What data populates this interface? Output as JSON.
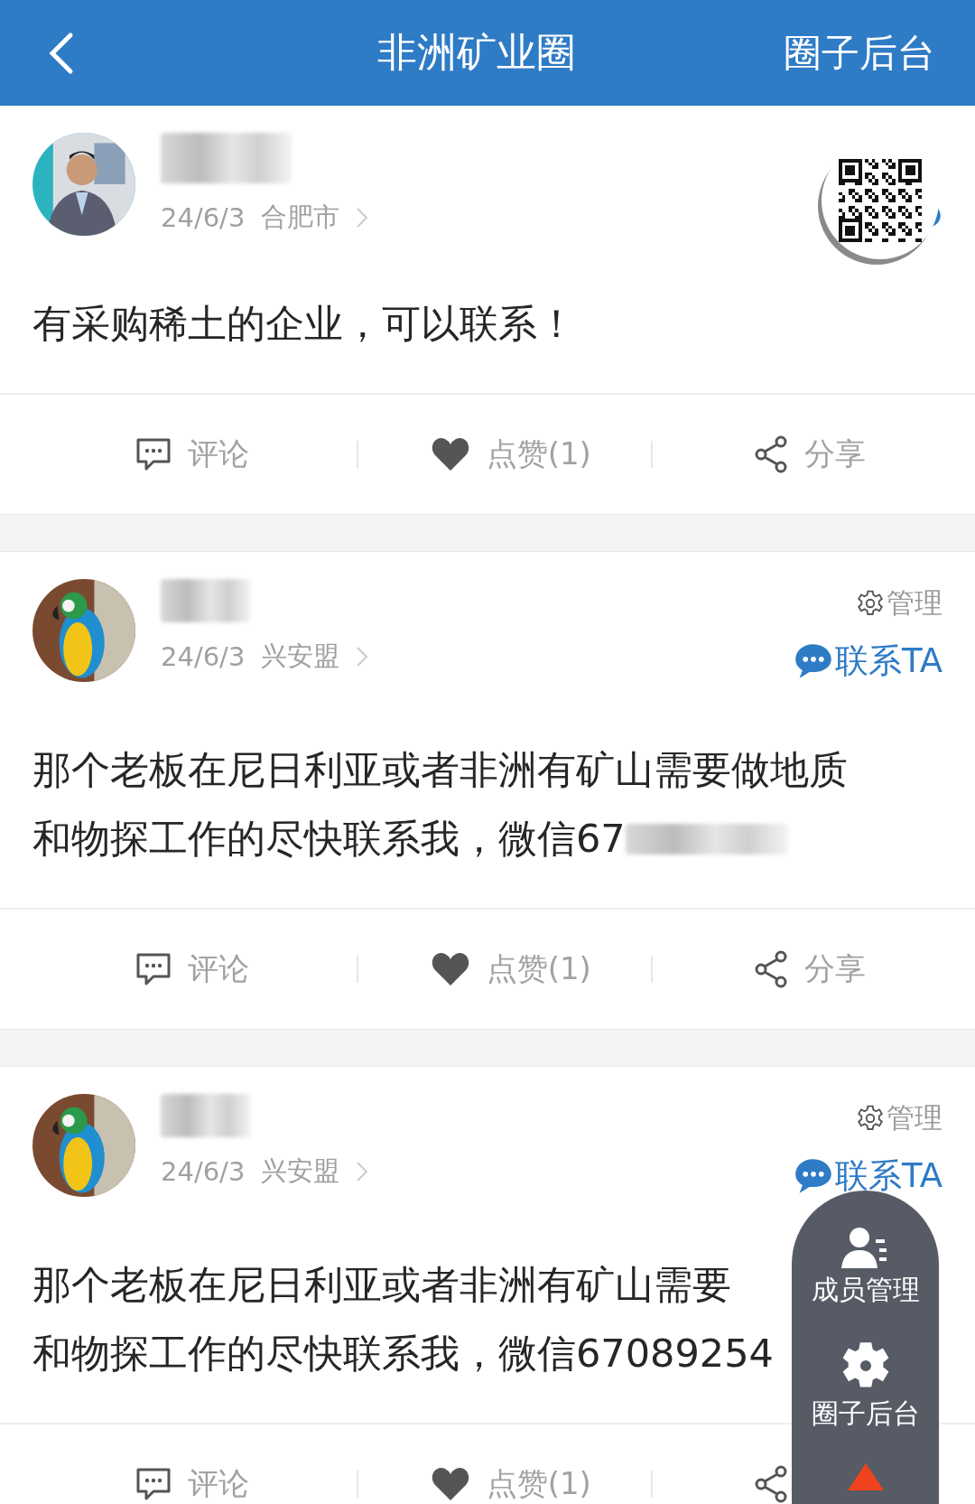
{
  "header": {
    "title": "非洲矿业圈",
    "action": "圈子后台"
  },
  "posts": [
    {
      "avatar": {
        "kind": "picture"
      },
      "date": "24/6/3",
      "location": "合肥市",
      "can_manage": false,
      "qr_badge": true,
      "body": [
        "有采购稀土的企业，可以联系！"
      ],
      "phone_blurred": false,
      "actions": [
        {
          "kind": "comment",
          "label": "评论"
        },
        {
          "kind": "like",
          "label": "点赞(1)"
        },
        {
          "kind": "share",
          "label": "分享"
        }
      ]
    },
    {
      "avatar": {
        "kind": "picture"
      },
      "date": "24/6/3",
      "location": "兴安盟",
      "can_manage": true,
      "manage": "管理",
      "contact": "联系TA",
      "qr_badge": false,
      "body": [
        "那个老板在尼日利亚或者非洲有矿山需要做地质",
        "和物探工作的尽快联系我，微信67"
      ],
      "phone_blurred": true,
      "actions": [
        {
          "kind": "comment",
          "label": "评论"
        },
        {
          "kind": "like",
          "label": "点赞(1)"
        },
        {
          "kind": "share",
          "label": "分享"
        }
      ]
    },
    {
      "avatar": {
        "kind": "picture"
      },
      "date": "24/6/3",
      "location": "兴安盟",
      "can_manage": true,
      "manage": "管理",
      "contact": "联系TA",
      "qr_badge": false,
      "body": [
        "那个老板在尼日利亚或者非洲有矿山需要",
        "和物探工作的尽快联系我，微信67089254"
      ],
      "phone_blurred": false,
      "actions": [
        {
          "kind": "comment",
          "label": "评论"
        },
        {
          "kind": "like",
          "label": "点赞(1)"
        },
        {
          "kind": "share"
        }
      ]
    }
  ],
  "float_menu": {
    "items": [
      {
        "kind": "members",
        "label": "成员管理"
      },
      {
        "kind": "settings",
        "label": "圈子后台"
      }
    ]
  }
}
